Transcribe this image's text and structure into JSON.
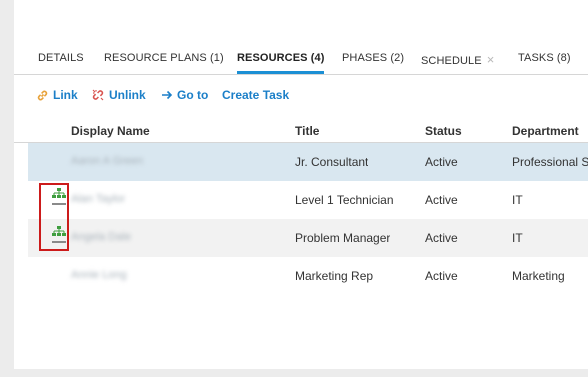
{
  "tabs": [
    {
      "label": "DETAILS",
      "active": false
    },
    {
      "label": "RESOURCE PLANS (1)",
      "active": false
    },
    {
      "label": "RESOURCES (4)",
      "active": true
    },
    {
      "label": "PHASES (2)",
      "active": false
    },
    {
      "label": "SCHEDULE",
      "active": false,
      "close_symbol": "×"
    },
    {
      "label": "TASKS (8)",
      "active": false
    }
  ],
  "toolbar": {
    "link_label": "Link",
    "unlink_label": "Unlink",
    "goto_label": "Go to",
    "create_task_label": "Create Task"
  },
  "table": {
    "columns": [
      "Display Name",
      "Title",
      "Status",
      "Department"
    ],
    "rows": [
      {
        "name": "Aaron A Green",
        "title": "Jr. Consultant",
        "status": "Active",
        "department": "Professional Se",
        "selected": true,
        "org_icon": false
      },
      {
        "name": "Alan Taylor",
        "title": "Level 1 Technician",
        "status": "Active",
        "department": "IT",
        "selected": false,
        "org_icon": true
      },
      {
        "name": "Angela Dale",
        "title": "Problem Manager",
        "status": "Active",
        "department": "IT",
        "selected": false,
        "org_icon": true
      },
      {
        "name": "Annie Long",
        "title": "Marketing Rep",
        "status": "Active",
        "department": "Marketing",
        "selected": false,
        "org_icon": false
      }
    ]
  },
  "colors": {
    "accent": "#1b7fc8",
    "tab_underline": "#1b8fd4",
    "unlink_icon": "#d9534f",
    "link_icon": "#e8a23a",
    "highlight_box": "#cc1b1b",
    "org_icon": "#3f9e3f"
  }
}
